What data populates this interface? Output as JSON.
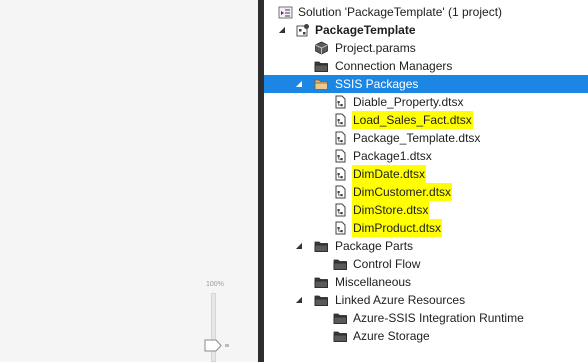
{
  "zoom": {
    "label": "100%"
  },
  "tree": {
    "solution": {
      "label": "Solution 'PackageTemplate' (1 project)"
    },
    "project": {
      "label": "PackageTemplate"
    },
    "project_params": {
      "label": "Project.params"
    },
    "connection_managers": {
      "label": "Connection Managers"
    },
    "ssis_packages": {
      "label": "SSIS Packages"
    },
    "packages": [
      {
        "label": "Diable_Property.dtsx",
        "highlighted": false
      },
      {
        "label": "Load_Sales_Fact.dtsx",
        "highlighted": true
      },
      {
        "label": "Package_Template.dtsx",
        "highlighted": false
      },
      {
        "label": "Package1.dtsx",
        "highlighted": false
      },
      {
        "label": "DimDate.dtsx",
        "highlighted": true
      },
      {
        "label": "DimCustomer.dtsx",
        "highlighted": true
      },
      {
        "label": "DimStore.dtsx",
        "highlighted": true
      },
      {
        "label": "DimProduct.dtsx",
        "highlighted": true
      }
    ],
    "package_parts": {
      "label": "Package Parts"
    },
    "control_flow": {
      "label": "Control Flow"
    },
    "miscellaneous": {
      "label": "Miscellaneous"
    },
    "linked_azure": {
      "label": "Linked Azure Resources"
    },
    "azure_ssis_ir": {
      "label": "Azure-SSIS Integration Runtime"
    },
    "azure_storage": {
      "label": "Azure Storage"
    }
  },
  "colors": {
    "selection": "#1c86e4",
    "highlight": "#ffff00",
    "splitter": "#2d2d30"
  }
}
